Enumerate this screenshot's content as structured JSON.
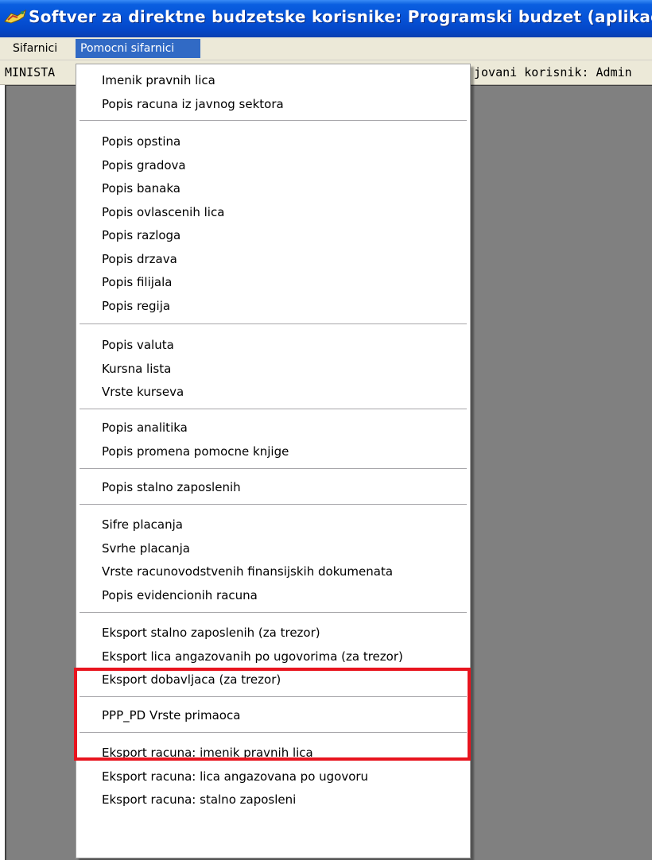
{
  "window": {
    "title": "Softver za direktne budzetske korisnike: Programski budzet (aplikacija",
    "icon": "app-icon",
    "title_color": "#0653d8"
  },
  "menubar": {
    "items": [
      {
        "label": "Sifarnici"
      },
      {
        "label": "Pomocni sifarnici"
      }
    ],
    "active_color": "#316ac5"
  },
  "infobar": {
    "left_text": "MINISTA",
    "right_text": "jovani korisnik: Admin"
  },
  "dropdown": {
    "items": [
      "Imenik pravnih lica",
      "Popis racuna iz javnog sektora",
      "Popis opstina",
      "Popis gradova",
      "Popis banaka",
      "Popis ovlascenih lica",
      "Popis razloga",
      "Popis drzava",
      "Popis filijala",
      "Popis regija",
      "Popis valuta",
      "Kursna lista",
      "Vrste kurseva",
      "Popis analitika",
      "Popis promena pomocne knjige",
      "Popis stalno zaposlenih",
      "Sifre placanja",
      "Svrhe placanja",
      "Vrste racunovodstvenih finansijskih dokumenata",
      "Popis evidencionih racuna",
      "Eksport stalno zaposlenih (za trezor)",
      "Eksport lica angazovanih po ugovorima (za trezor)",
      "Eksport dobavljaca (za trezor)",
      "PPP_PD Vrste primaoca",
      "Eksport racuna: imenik pravnih lica",
      "Eksport racuna: lica angazovana po ugovoru",
      "Eksport racuna: stalno zaposleni"
    ],
    "highlight_color": "#e8141e"
  },
  "workspace": {
    "background": "#808080"
  }
}
